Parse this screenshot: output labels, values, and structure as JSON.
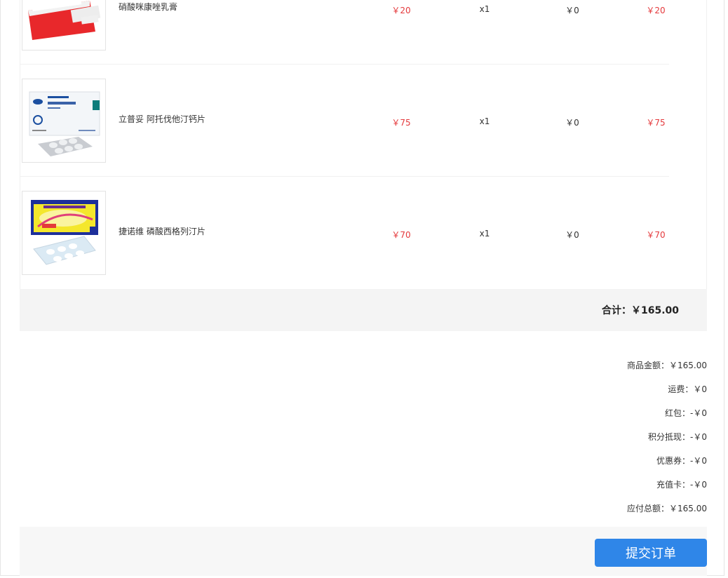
{
  "items": [
    {
      "name": "硝酸咪康唑乳膏",
      "price": "￥20",
      "quantity": "x1",
      "discount": "￥0",
      "subtotal": "￥20",
      "image": "red-white-cream-box-image"
    },
    {
      "name": "立普妥 阿托伐他汀钙片",
      "price": "￥75",
      "quantity": "x1",
      "discount": "￥0",
      "subtotal": "￥75",
      "image": "white-blue-tablet-box-image"
    },
    {
      "name": "捷诺维 磷酸西格列汀片",
      "price": "￥70",
      "quantity": "x1",
      "discount": "￥0",
      "subtotal": "￥70",
      "image": "yellow-blue-tablet-box-image"
    }
  ],
  "total": {
    "label": "合计：",
    "value": "￥165.00"
  },
  "summary": [
    {
      "label": "商品金额：",
      "value": "￥165.00"
    },
    {
      "label": "运费：",
      "value": "￥0"
    },
    {
      "label": "红包：",
      "value": "-￥0"
    },
    {
      "label": "积分抵现：",
      "value": "-￥0"
    },
    {
      "label": "优惠券：",
      "value": "-￥0"
    },
    {
      "label": "充值卡：",
      "value": "-￥0"
    },
    {
      "label": "应付总额：",
      "value": "￥165.00"
    }
  ],
  "submit": {
    "label": "提交订单"
  },
  "colors": {
    "accent": "#2f86e8",
    "price_red": "#e4393c",
    "bar_gray": "#f4f4f4"
  }
}
